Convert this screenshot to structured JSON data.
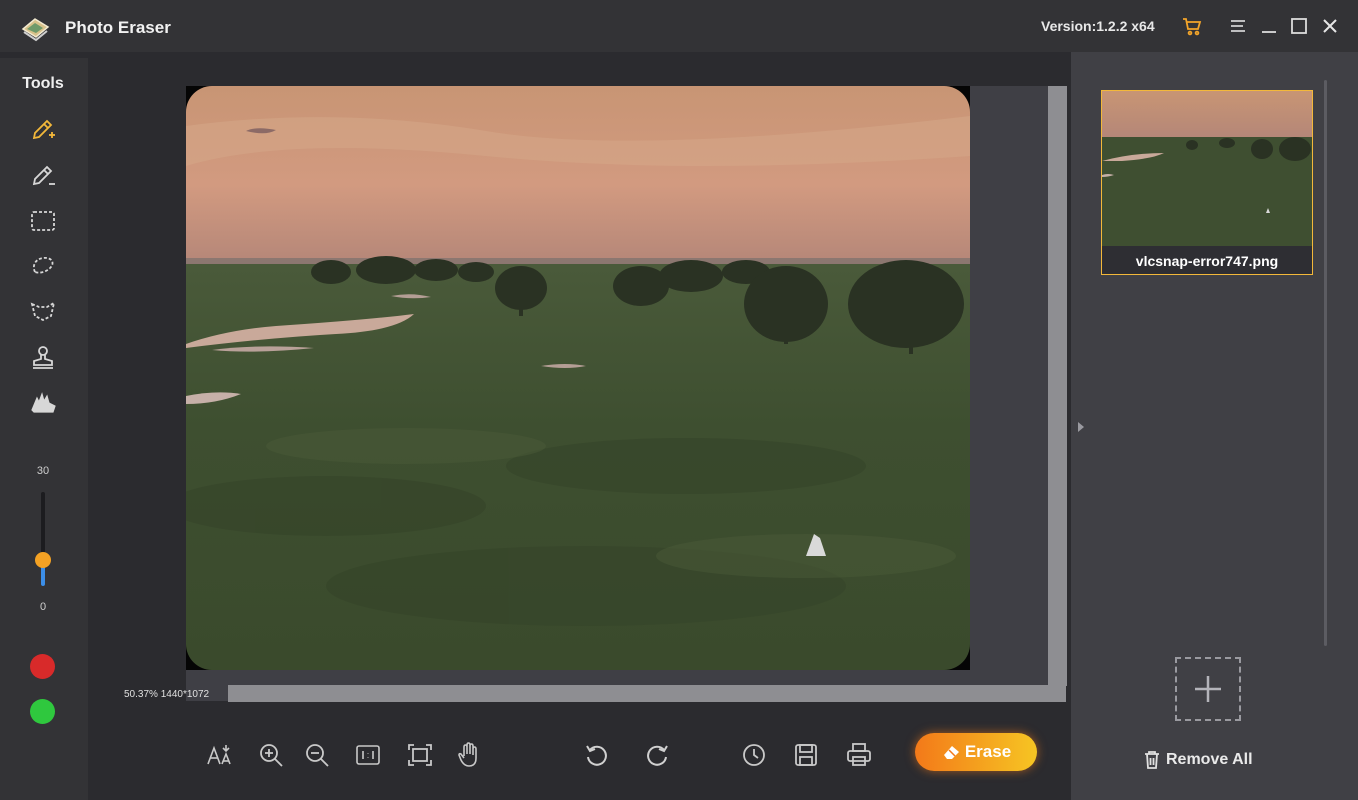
{
  "app": {
    "title": "Photo Eraser",
    "version": "Version:1.2.2 x64"
  },
  "sidebar": {
    "title": "Tools",
    "tools": [
      {
        "name": "smart-brush"
      },
      {
        "name": "brush"
      },
      {
        "name": "rectangle-select"
      },
      {
        "name": "lasso"
      },
      {
        "name": "polygon-lasso"
      },
      {
        "name": "clone-stamp"
      },
      {
        "name": "eraser-hand"
      }
    ],
    "brush_size": {
      "max": "30",
      "min": "0",
      "value_fraction": 0.23
    },
    "colors": {
      "mark": "#d82a2a",
      "keep": "#2fc83e"
    }
  },
  "canvas": {
    "zoom_info": "50.37% 1440*1072"
  },
  "toolbar": {
    "erase_label": "Erase"
  },
  "files": {
    "items": [
      {
        "name": "vlcsnap-error747.png",
        "selected": true
      }
    ],
    "remove_all_label": "Remove All"
  },
  "colors": {
    "accent": "#f3b83a",
    "erase_start": "#f37919",
    "erase_end": "#f6c523"
  },
  "icons": {
    "titlebar": [
      "cart-icon",
      "menu-icon",
      "minimize-icon",
      "maximize-icon",
      "close-icon"
    ],
    "toolbar": [
      "text-size-icon",
      "zoom-in-icon",
      "zoom-out-icon",
      "actual-size-icon",
      "fit-screen-icon",
      "hand-icon",
      "undo-icon",
      "redo-icon",
      "history-icon",
      "save-icon",
      "print-icon"
    ]
  }
}
